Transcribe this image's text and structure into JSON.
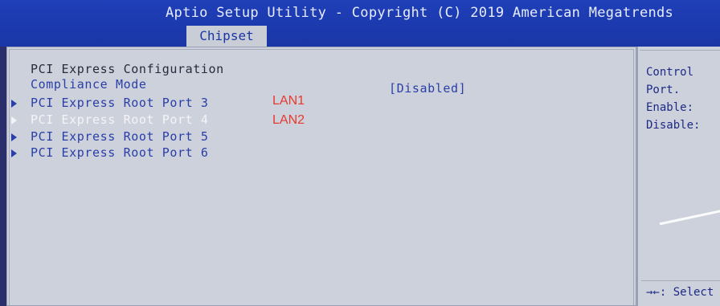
{
  "header": {
    "title": "Aptio Setup Utility - Copyright (C) 2019 American Megatrends",
    "tabs": [
      {
        "label": "Chipset",
        "active": true
      }
    ]
  },
  "main": {
    "section_title": "PCI Express Configuration",
    "compliance": {
      "label": "Compliance Mode",
      "value": "[Disabled]"
    },
    "items": [
      {
        "label": "PCI Express Root Port 3",
        "annotation": "LAN1",
        "selected": false
      },
      {
        "label": "PCI Express Root Port 4",
        "annotation": "LAN2",
        "selected": true
      },
      {
        "label": "PCI Express Root Port 5",
        "annotation": "",
        "selected": false
      },
      {
        "label": "PCI Express Root Port 6",
        "annotation": "",
        "selected": false
      }
    ]
  },
  "help": {
    "lines": [
      "Control",
      "Port.",
      "Enable:",
      "Disable:"
    ],
    "key_hint": "→←: Select"
  },
  "colors": {
    "header_bg": "#1f3fb8",
    "panel_bg": "#cdd1db",
    "item_text": "#2a3ea8",
    "selected_text": "#f4f4f8",
    "annotation_red": "#e53a2f"
  }
}
